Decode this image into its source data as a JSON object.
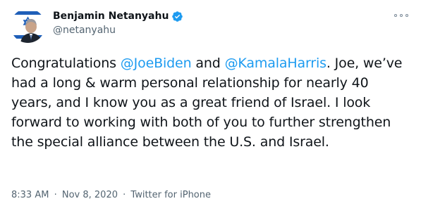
{
  "author": {
    "display_name": "Benjamin Netanyahu",
    "handle": "@netanyahu",
    "verified": true,
    "avatar_icon": "israeli-flag-profile-photo"
  },
  "tweet": {
    "segments": [
      {
        "type": "text",
        "value": "Congratulations "
      },
      {
        "type": "mention",
        "value": "@JoeBiden"
      },
      {
        "type": "text",
        "value": " and "
      },
      {
        "type": "mention",
        "value": "@KamalaHarris"
      },
      {
        "type": "text",
        "value": ". Joe, we’ve had a long & warm personal relationship for nearly 40 years, and I know you as a great friend of Israel. I look forward to working with both of you to further strengthen the special alliance between the U.S. and Israel."
      }
    ]
  },
  "meta": {
    "time": "8:33 AM",
    "separator": "·",
    "date": "Nov 8, 2020",
    "source": "Twitter for iPhone"
  },
  "icons": {
    "verified": "verified-badge-icon",
    "more": "more-options-icon"
  },
  "colors": {
    "link": "#1d9bf0",
    "secondary_text": "#536471",
    "primary_text": "#0f1419",
    "verified_badge": "#1d9bf0"
  }
}
